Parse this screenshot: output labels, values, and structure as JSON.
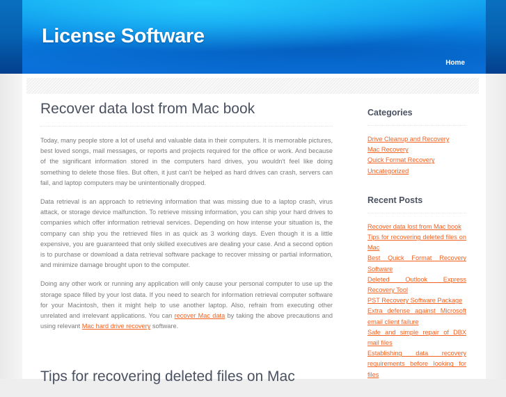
{
  "header": {
    "site_title": "License Software",
    "nav": [
      {
        "label": "Home"
      }
    ]
  },
  "main": {
    "posts": [
      {
        "title": "Recover data lost from Mac book",
        "paragraphs": [
          "Today, many people store a lot of useful and valuable data in their computers. It is memorable pictures, best loved songs, mail messages, or reports and projects required for the office or work. And because of the significant information stored in the computers hard drives, you wouldn't feel like doing something to delete those files. But often, it just can't be helped as hard drives can crash, servers can fail, and laptop computers may be unintentionally dropped.",
          "Data retrieval is an approach to retrieving information that was missing due to a laptop crash, virus attack, or storage device malfunction. To retrieve missing information, you can ship your hard drives to companies which offer information retrieval services. Depending on how intense your situation is, the company can ship you the retrieved files in as quick as 3 working days. Even though it is a little expensive, you are guaranteed that only skilled executives are dealing your case. And a second option is to purchase or download a data retrieval software package to recover missing or partial information, and minimize damage brought upon to the computer."
        ],
        "paragraph3": {
          "text_before_link1": "Doing any other work or running any application will only cause your personal computer to use up the storage space filled by your lost data. If you need to search for information retrieval computer software for your Macintosh, then it might help to use another laptop. Also, refrain from executing other unrelated and irrelevant applications. You can ",
          "link1": "recover Mac data",
          "text_between": " by taking the above precautions and using relevant ",
          "link2": "Mac hard drive recovery",
          "text_after": " software."
        }
      },
      {
        "title": "Tips for recovering deleted files on Mac"
      }
    ]
  },
  "sidebar": {
    "categories": {
      "title": "Categories",
      "items": [
        "Drive Cleanup and Recovery",
        "Mac Recovery",
        "Quick Format Recovery",
        "Uncategorized"
      ]
    },
    "recent_posts": {
      "title": "Recent Posts",
      "items": [
        "Recover data lost from Mac book",
        "Tips for recovering deleted files on Mac",
        "Best Quick Format Recovery Software",
        "Deleted Outlook Express Recovery Tool",
        "PST Recovery Software Package",
        "Extra defense against Microsoft email client failure",
        "Safe and simple repair of DBX mail files",
        "Establishing data recovery requirements before looking for files"
      ]
    }
  },
  "colors": {
    "header_blue": "#0a8ae6",
    "link_orange": "#f2601e",
    "title_gray": "#4a5160",
    "body_text": "#7a7a7a"
  }
}
